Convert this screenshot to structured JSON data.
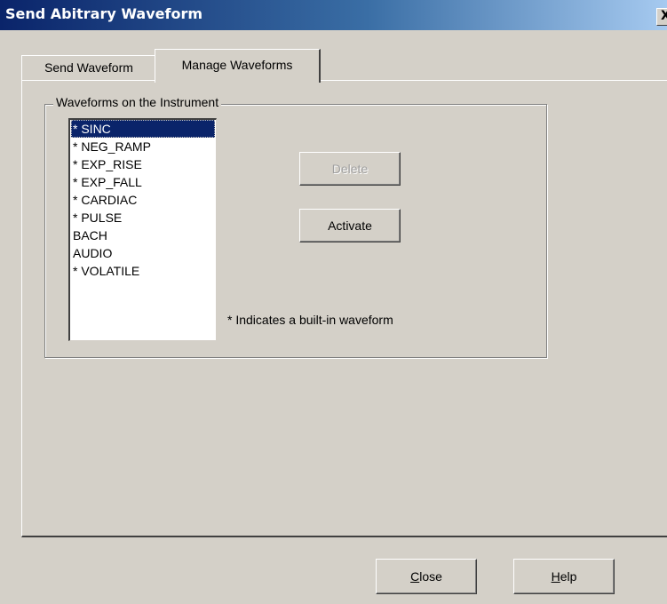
{
  "window": {
    "title": "Send Abitrary Waveform",
    "close_glyph": "X"
  },
  "tabs": [
    {
      "label": "Send Waveform",
      "active": false
    },
    {
      "label": "Manage Waveforms",
      "active": true
    }
  ],
  "group": {
    "label": "Waveforms on the Instrument"
  },
  "waveforms": {
    "items": [
      "* SINC",
      "* NEG_RAMP",
      "* EXP_RISE",
      "* EXP_FALL",
      "* CARDIAC",
      "* PULSE",
      "BACH",
      "AUDIO",
      "* VOLATILE"
    ],
    "selected": "* SINC"
  },
  "buttons": {
    "delete_label": "Delete",
    "delete_enabled": false,
    "activate_label": "Activate",
    "close_label": "Close",
    "close_mnemonic": "C",
    "help_label": "Help",
    "help_mnemonic": "H"
  },
  "note": "* Indicates a built-in waveform",
  "colors": {
    "dialog_bg": "#d4d0c8",
    "title_bar": "#0a246a",
    "selection": "#0a246a"
  }
}
